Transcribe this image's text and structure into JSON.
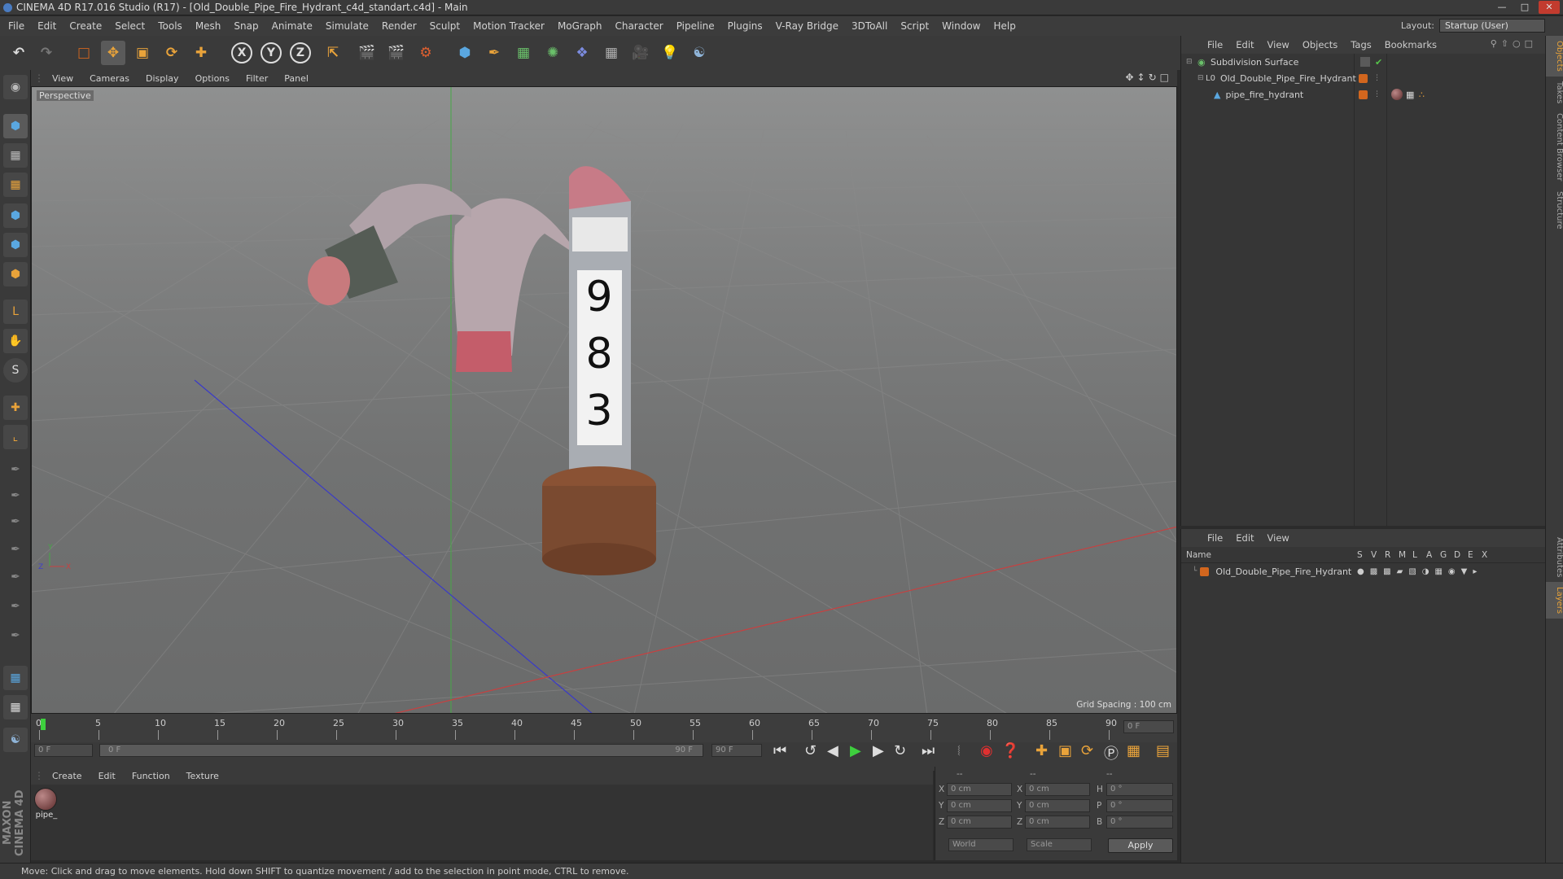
{
  "window": {
    "title": "CINEMA 4D R17.016 Studio (R17) - [Old_Double_Pipe_Fire_Hydrant_c4d_standart.c4d] - Main"
  },
  "menu": [
    "File",
    "Edit",
    "Create",
    "Select",
    "Tools",
    "Mesh",
    "Snap",
    "Animate",
    "Simulate",
    "Render",
    "Sculpt",
    "Motion Tracker",
    "MoGraph",
    "Character",
    "Pipeline",
    "Plugins",
    "V-Ray Bridge",
    "3DToAll",
    "Script",
    "Window",
    "Help"
  ],
  "layout": {
    "label": "Layout:",
    "value": "Startup (User)"
  },
  "viewport": {
    "menu": [
      "View",
      "Cameras",
      "Display",
      "Options",
      "Filter",
      "Panel"
    ],
    "label": "Perspective",
    "grid_spacing": "Grid Spacing : 100 cm",
    "hydrant_numbers": [
      "9",
      "8",
      "3"
    ]
  },
  "timeline": {
    "ticks": [
      "0",
      "5",
      "10",
      "15",
      "20",
      "25",
      "30",
      "35",
      "40",
      "45",
      "50",
      "55",
      "60",
      "65",
      "70",
      "75",
      "80",
      "85",
      "90"
    ],
    "current_frame": "0 F",
    "start_field": "0 F",
    "range_start": "0 F",
    "range_end": "90 F",
    "end_field": "90 F"
  },
  "material_manager": {
    "menu": [
      "Create",
      "Edit",
      "Function",
      "Texture"
    ],
    "material_name": "pipe_"
  },
  "coordinates": {
    "header": [
      "--",
      "--",
      "--"
    ],
    "rows": [
      {
        "a": "X",
        "av": "0 cm",
        "b": "X",
        "bv": "0 cm",
        "c": "H",
        "cv": "0 °"
      },
      {
        "a": "Y",
        "av": "0 cm",
        "b": "Y",
        "bv": "0 cm",
        "c": "P",
        "cv": "0 °"
      },
      {
        "a": "Z",
        "av": "0 cm",
        "b": "Z",
        "bv": "0 cm",
        "c": "B",
        "cv": "0 °"
      }
    ],
    "mode": "World",
    "scale": "Scale",
    "apply": "Apply"
  },
  "object_manager": {
    "menu": [
      "File",
      "Edit",
      "View",
      "Objects",
      "Tags",
      "Bookmarks"
    ],
    "objects": [
      {
        "name": "Subdivision Surface"
      },
      {
        "name": "Old_Double_Pipe_Fire_Hydrant"
      },
      {
        "name": "pipe_fire_hydrant"
      }
    ]
  },
  "layer_manager": {
    "menu": [
      "File",
      "Edit",
      "View"
    ],
    "columns": [
      "Name",
      "S",
      "V",
      "R",
      "M",
      "L",
      "A",
      "G",
      "D",
      "E",
      "X"
    ],
    "layer_name": "Old_Double_Pipe_Fire_Hydrant"
  },
  "side_tabs_top": [
    "Objects",
    "Takes",
    "Content Browser",
    "Structure"
  ],
  "side_tabs_bottom": [
    "Attributes",
    "Layers"
  ],
  "brand": "MAXON CINEMA 4D",
  "status": "Move: Click and drag to move elements. Hold down SHIFT to quantize movement / add to the selection in point mode, CTRL to remove.",
  "colors": {
    "accent": "#d2661e",
    "check": "#55c24a",
    "axis_x": "#d04040",
    "axis_y": "#46a846",
    "axis_z": "#4040c8"
  }
}
